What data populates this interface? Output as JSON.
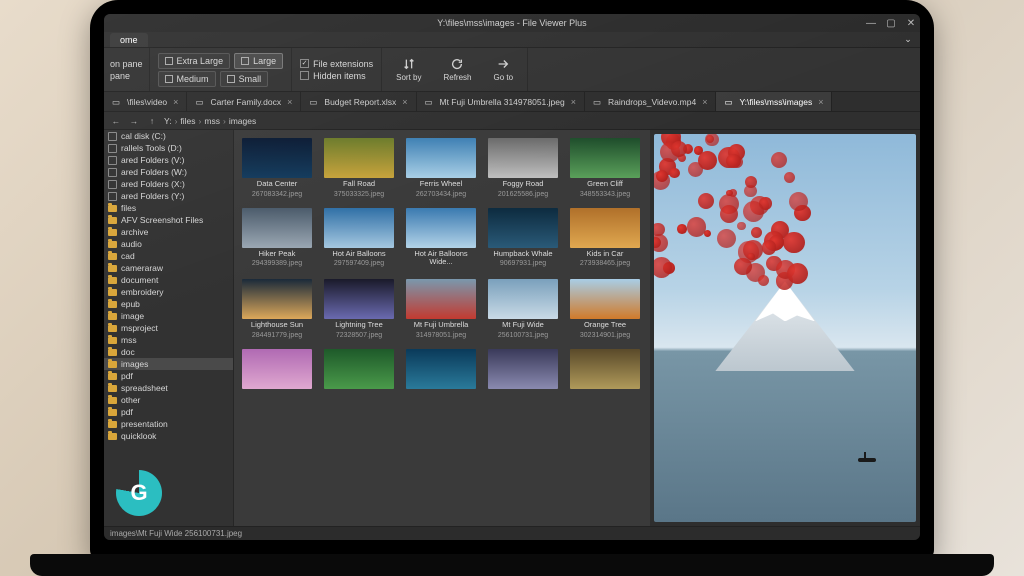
{
  "window": {
    "title": "Y:\\files\\mss\\images - File Viewer Plus"
  },
  "menubar": {
    "home": "ome"
  },
  "ribbon": {
    "pane1": "on pane",
    "pane2": "pane",
    "size_extra_large": "Extra Large",
    "size_large": "Large",
    "size_medium": "Medium",
    "size_small": "Small",
    "check_file_ext": "File extensions",
    "check_hidden": "Hidden items",
    "sort_by": "Sort by",
    "refresh": "Refresh",
    "go_to": "Go to"
  },
  "tabs": [
    {
      "label": "\\files\\video"
    },
    {
      "label": "Carter Family.docx"
    },
    {
      "label": "Budget Report.xlsx"
    },
    {
      "label": "Mt Fuji Umbrella 314978051.jpeg"
    },
    {
      "label": "Raindrops_Videvo.mp4"
    },
    {
      "label": "Y:\\files\\mss\\images"
    }
  ],
  "breadcrumb": [
    "Y:",
    "files",
    "mss",
    "images"
  ],
  "drives": [
    "cal disk (C:)",
    "rallels Tools (D:)",
    "ared Folders (V:)",
    "ared Folders (W:)",
    "ared Folders (X:)",
    "ared Folders (Y:)"
  ],
  "tree": {
    "root": "files",
    "l1": [
      "AFV Screenshot Files",
      "archive",
      "audio",
      "cad",
      "cameraraw",
      "document",
      "embroidery",
      "epub",
      "image",
      "msproject",
      "mss"
    ],
    "mss": [
      "doc",
      "images",
      "pdf",
      "spreadsheet"
    ],
    "tail": [
      "other",
      "pdf",
      "presentation",
      "quicklook"
    ]
  },
  "thumbs": [
    [
      {
        "name": "Data Center",
        "file": "267083342.jpeg",
        "bg": "linear-gradient(#0a1a33,#123a5c)"
      },
      {
        "name": "Fall Road",
        "file": "375033325.jpeg",
        "bg": "linear-gradient(#6b7a2a,#c7a23a)"
      },
      {
        "name": "Ferris Wheel",
        "file": "262703434.jpeg",
        "bg": "linear-gradient(#3d7fb3,#a8cfe6)"
      },
      {
        "name": "Foggy Road",
        "file": "201625586.jpeg",
        "bg": "linear-gradient(#6a6a6a,#bfbfbf)"
      },
      {
        "name": "Green Cliff",
        "file": "348553343.jpeg",
        "bg": "linear-gradient(#1e4d2b,#5aa05a)"
      }
    ],
    [
      {
        "name": "Hiker Peak",
        "file": "294399389.jpeg",
        "bg": "linear-gradient(#4a5a6a,#9aa7b3)"
      },
      {
        "name": "Hot Air Balloons",
        "file": "297597409.jpeg",
        "bg": "linear-gradient(#2f6fa6,#a5c8e0)"
      },
      {
        "name": "Hot Air Balloons Wide...",
        "file": "",
        "bg": "linear-gradient(#3a7ab0,#b3d3e8)"
      },
      {
        "name": "Humpback Whale",
        "file": "90697931.jpeg",
        "bg": "linear-gradient(#0d2b3f,#2a5a78)"
      },
      {
        "name": "Kids in Car",
        "file": "273938465.jpeg",
        "bg": "linear-gradient(#b0702a,#e0a850)"
      }
    ],
    [
      {
        "name": "Lighthouse Sun",
        "file": "284491779.jpeg",
        "bg": "linear-gradient(#1a2a3a,#dca85a)"
      },
      {
        "name": "Lightning Tree",
        "file": "72328507.jpeg",
        "bg": "linear-gradient(#1a1a2a,#6a6ab0)"
      },
      {
        "name": "Mt Fuji Umbrella",
        "file": "314978051.jpeg",
        "bg": "linear-gradient(#7a98ad,#c23a30)"
      },
      {
        "name": "Mt Fuji Wide",
        "file": "256100731.jpeg",
        "bg": "linear-gradient(#7aa0bc,#c9dae6)"
      },
      {
        "name": "Orange Tree",
        "file": "302314901.jpeg",
        "bg": "linear-gradient(#a8cde6,#d07a2a)"
      }
    ],
    [
      {
        "name": "",
        "file": "",
        "bg": "linear-gradient(#b06ab3,#e0a8d0)"
      },
      {
        "name": "",
        "file": "",
        "bg": "linear-gradient(#1e5a2a,#4a9a4a)"
      },
      {
        "name": "",
        "file": "",
        "bg": "linear-gradient(#0a3a5a,#2a7a9a)"
      },
      {
        "name": "",
        "file": "",
        "bg": "linear-gradient(#3a3a5a,#8a8ab0)"
      },
      {
        "name": "",
        "file": "",
        "bg": "linear-gradient(#5a4a2a,#b09a5a)"
      }
    ]
  ],
  "status": "images\\Mt Fuji Wide 256100731.jpeg"
}
